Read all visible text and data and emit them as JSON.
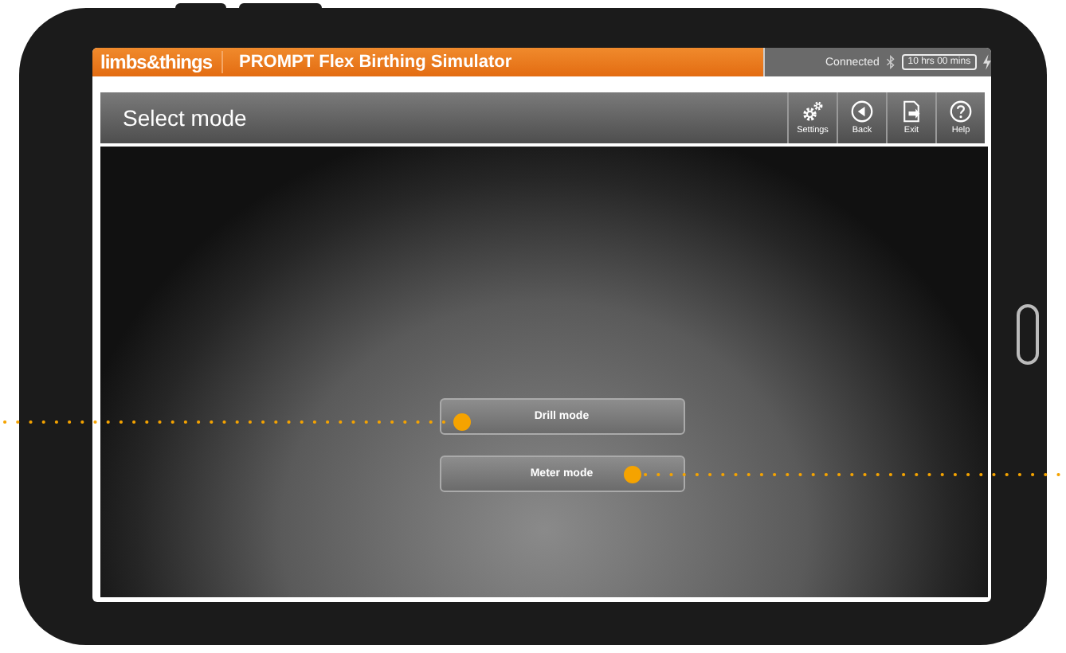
{
  "header": {
    "logo": "limbs&things",
    "title": "PROMPT Flex Birthing Simulator",
    "status": "Connected",
    "timer": "10 hrs 00 mins"
  },
  "toolbar": {
    "title": "Select mode",
    "buttons": [
      {
        "kind": "settings",
        "label": "Settings"
      },
      {
        "kind": "back",
        "label": "Back"
      },
      {
        "kind": "exit",
        "label": "Exit"
      },
      {
        "kind": "help",
        "label": "Help"
      }
    ]
  },
  "modes": [
    {
      "label": "Drill mode"
    },
    {
      "label": "Meter mode"
    }
  ]
}
